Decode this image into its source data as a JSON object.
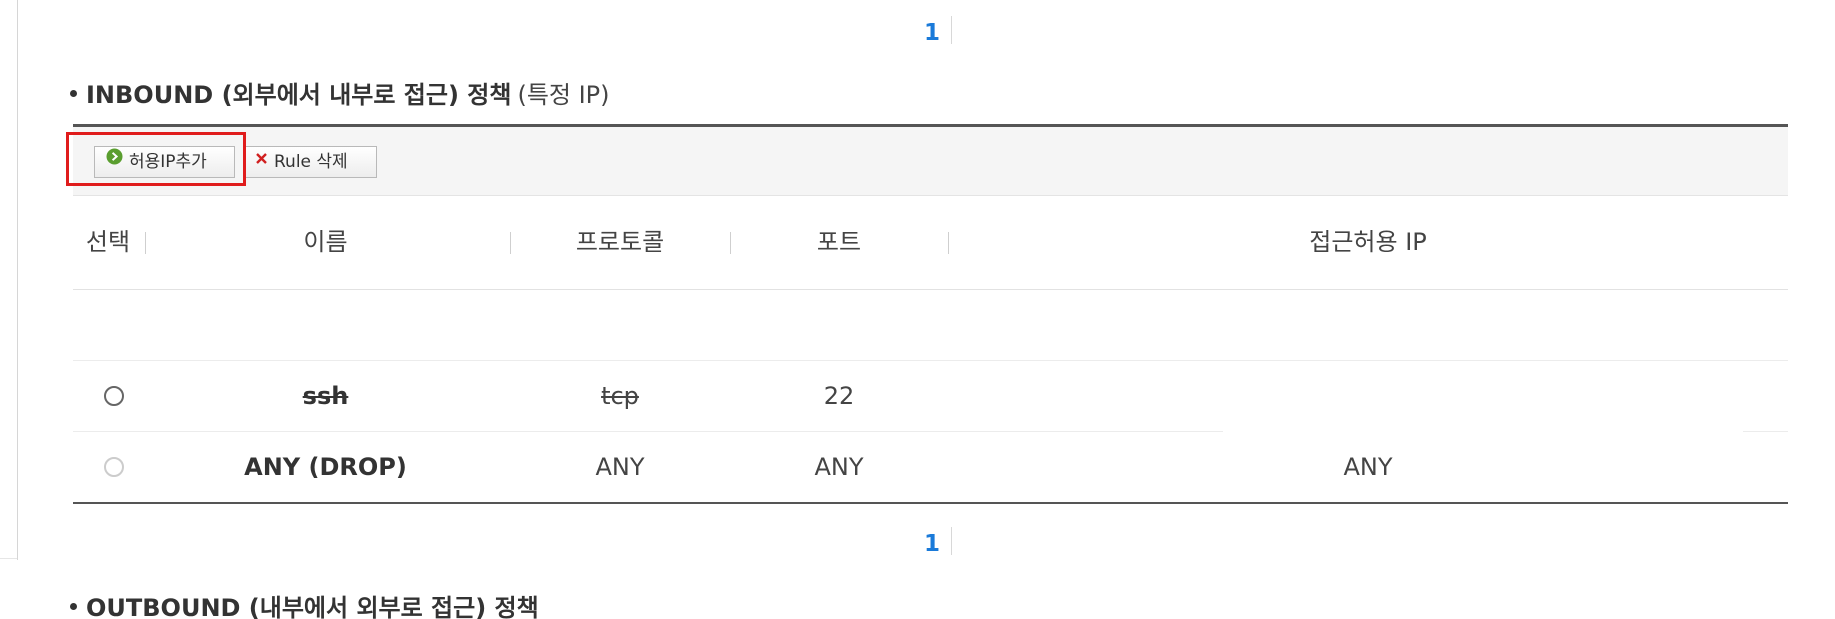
{
  "pagination_top": {
    "page": "1"
  },
  "inbound": {
    "title": "INBOUND (외부에서 내부로 접근) 정책",
    "subtitle": "(특정 IP)",
    "toolbar": {
      "add_button": "허용IP추가",
      "delete_button": "Rule 삭제"
    },
    "columns": [
      "선택",
      "이름",
      "프로토콜",
      "포트",
      "접근허용 IP"
    ],
    "rows": [
      {
        "name": "ssh",
        "protocol": "tcp",
        "port": "22",
        "allowed_ip": "",
        "selected": false
      },
      {
        "name": "ANY (DROP)",
        "protocol": "ANY",
        "port": "ANY",
        "allowed_ip": "ANY",
        "selected": false
      }
    ]
  },
  "pagination_bottom": {
    "page": "1"
  },
  "outbound": {
    "title": "OUTBOUND (내부에서 외부로 접근) 정책"
  },
  "colors": {
    "page_link": "#1a7ad9",
    "highlight": "#e01c1c",
    "add_icon": "#5a9e2f",
    "delete_icon": "#d12020"
  },
  "icons": {
    "add": "arrow-circle-icon",
    "delete": "x-icon"
  }
}
